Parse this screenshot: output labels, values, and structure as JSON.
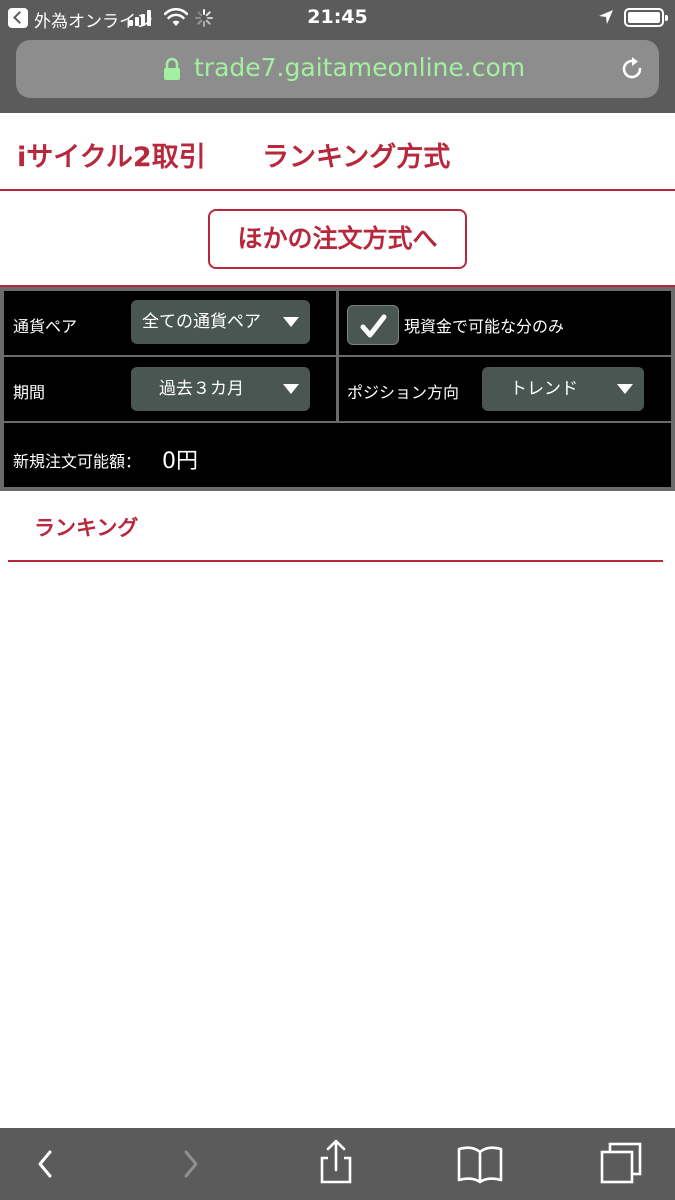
{
  "status_bar": {
    "back_app_label": "外為オンライン",
    "time": "21:45"
  },
  "browser": {
    "url": "trade7.gaitameonline.com"
  },
  "header": {
    "title": "iサイクル2取引",
    "subtitle": "ランキング方式"
  },
  "other_order_button": "ほかの注文方式へ",
  "filters": {
    "currency_pair_label": "通貨ペア",
    "currency_pair_value": "全ての通貨ペア",
    "cash_only_label": "現資金で可能な分のみ",
    "cash_only_checked": true,
    "period_label": "期間",
    "period_value": "過去３カ月",
    "position_direction_label": "ポジション方向",
    "position_direction_value": "トレンド",
    "available_amount_label": "新規注文可能額：",
    "available_amount_value": "0円"
  },
  "ranking": {
    "title": "ランキング"
  },
  "colors": {
    "accent": "#b8283c",
    "chrome": "#5b5b5b",
    "url_text": "#a3f0a0",
    "panel": "#000000",
    "select_bg": "#4a5652"
  },
  "icons": {
    "status": [
      "back-app-icon",
      "signal-icon",
      "wifi-icon",
      "loading-spinner-icon",
      "location-icon",
      "battery-icon"
    ],
    "browser": [
      "lock-icon",
      "reload-icon"
    ],
    "toolbar": [
      "back-icon",
      "forward-icon",
      "share-icon",
      "bookmarks-icon",
      "tabs-icon"
    ]
  }
}
